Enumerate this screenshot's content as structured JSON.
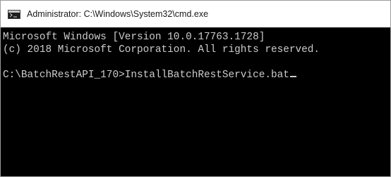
{
  "window": {
    "title": "Administrator: C:\\Windows\\System32\\cmd.exe",
    "icon": "cmd-icon"
  },
  "console": {
    "lines": [
      "Microsoft Windows [Version 10.0.17763.1728]",
      "(c) 2018 Microsoft Corporation. All rights reserved.",
      "",
      "C:\\BatchRestAPI_170>InstallBatchRestService.bat"
    ]
  },
  "colors": {
    "console_background": "#000000",
    "console_text": "#cccccc",
    "titlebar_background": "#ffffff"
  }
}
